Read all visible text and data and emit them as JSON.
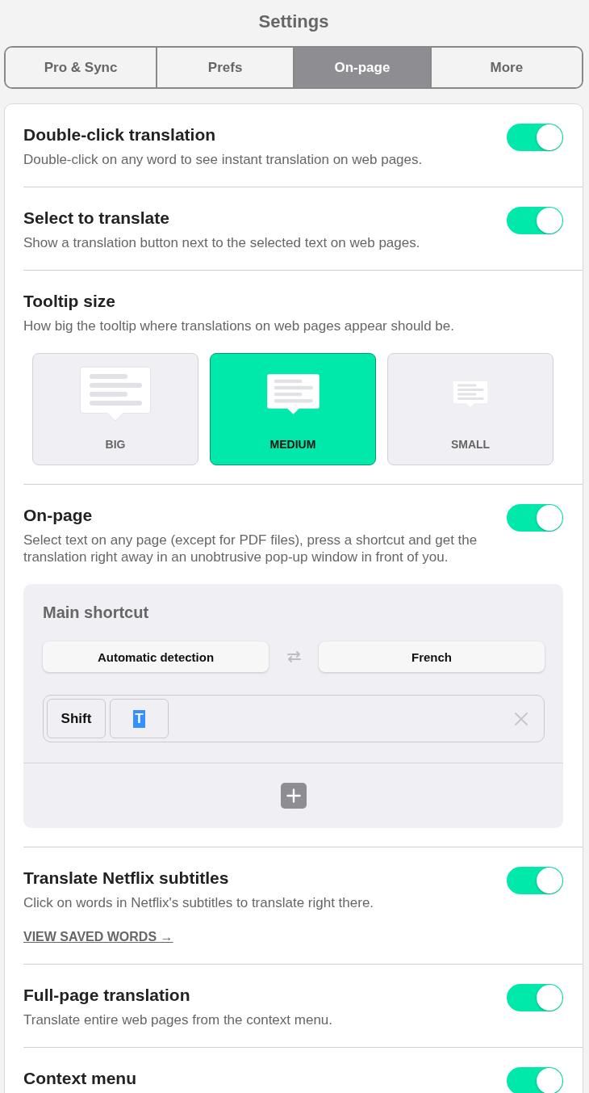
{
  "header": {
    "title": "Settings"
  },
  "tabs": [
    {
      "label": "Pro & Sync",
      "selected": false
    },
    {
      "label": "Prefs",
      "selected": false
    },
    {
      "label": "On-page",
      "selected": true
    },
    {
      "label": "More",
      "selected": false
    }
  ],
  "sections": [
    {
      "kind": "toggle",
      "title": "Double-click translation",
      "description": "Double-click on any word to see instant translation on web pages.",
      "on": true
    },
    {
      "kind": "toggle",
      "title": "Select to translate",
      "description": "Show a translation button next to the selected text on web pages.",
      "on": true
    },
    {
      "kind": "size_picker",
      "title": "Tooltip size",
      "description": "How big the tooltip where translations on web pages appear should be.",
      "options": [
        {
          "kind": "big",
          "label": "BIG",
          "selected": false
        },
        {
          "kind": "medium",
          "label": "MEDIUM",
          "selected": true
        },
        {
          "kind": "small",
          "label": "SMALL",
          "selected": false
        }
      ]
    },
    {
      "kind": "shortcut",
      "title": "On-page",
      "description": "Select text on any page (except for PDF files), press a shortcut and get the translation right away in an unobtrusive pop-up window in front of you.",
      "on": true,
      "panel": {
        "title": "Main shortcut",
        "source_language": "Automatic detection",
        "target_language": "French",
        "keys": [
          {
            "label": "Shift",
            "highlighted": false
          },
          {
            "label": "T",
            "highlighted": true
          }
        ]
      }
    },
    {
      "kind": "toggle",
      "title": "Translate Netflix subtitles",
      "description": "Click on words in Netflix's subtitles to translate right there.",
      "on": true,
      "link": "VIEW SAVED WORDS →"
    },
    {
      "kind": "toggle",
      "title": "Full-page translation",
      "description": "Translate entire web pages from the context menu.",
      "on": true
    },
    {
      "kind": "toggle",
      "title": "Context menu",
      "on": true
    }
  ]
}
